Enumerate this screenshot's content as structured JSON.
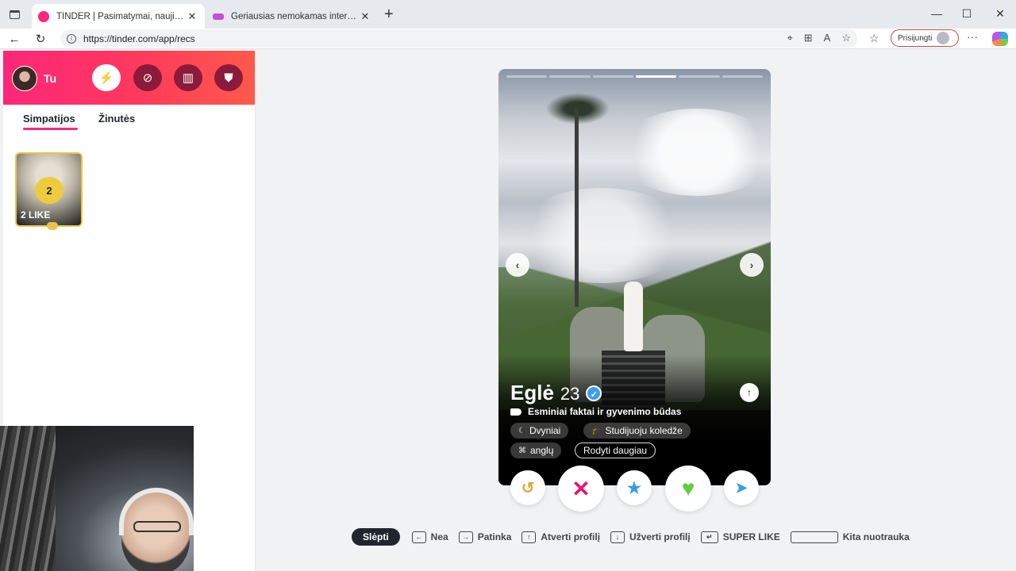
{
  "browser": {
    "tabs": [
      {
        "title": "TINDER | Pasimatymai, nauji draugai",
        "active": true
      },
      {
        "title": "Geriausias nemokamas internetinis",
        "active": false
      }
    ],
    "url": "https://tinder.com/app/recs",
    "signin_label": "Prisijungti"
  },
  "header": {
    "me_name": "Tu"
  },
  "left_tabs": {
    "likes": "Simpatijos",
    "messages": "Žinutės"
  },
  "likes_card": {
    "count": "2",
    "label": "2 LIKE"
  },
  "profile": {
    "name": "Eglė",
    "age": "23",
    "facts_title": "Esminiai faktai ir gyvenimo būdas",
    "chips": [
      "Dvyniai",
      "Studijuoju koledže",
      "anglų"
    ],
    "show_more": "Rodyti daugiau",
    "photos_total": 6,
    "photo_current": 4
  },
  "shortcuts": {
    "hide": "Slėpti",
    "nope": "Nea",
    "like": "Patinka",
    "open_profile": "Atverti profilį",
    "close_profile": "Užverti profilį",
    "super_like": "SUPER LIKE",
    "next_photo": "Kita nuotrauka"
  },
  "colors": {
    "brand_pink": "#fd267a",
    "brand_orange": "#ff5a4a",
    "verified_blue": "#3e9cf2",
    "gold": "#eecb3c"
  }
}
